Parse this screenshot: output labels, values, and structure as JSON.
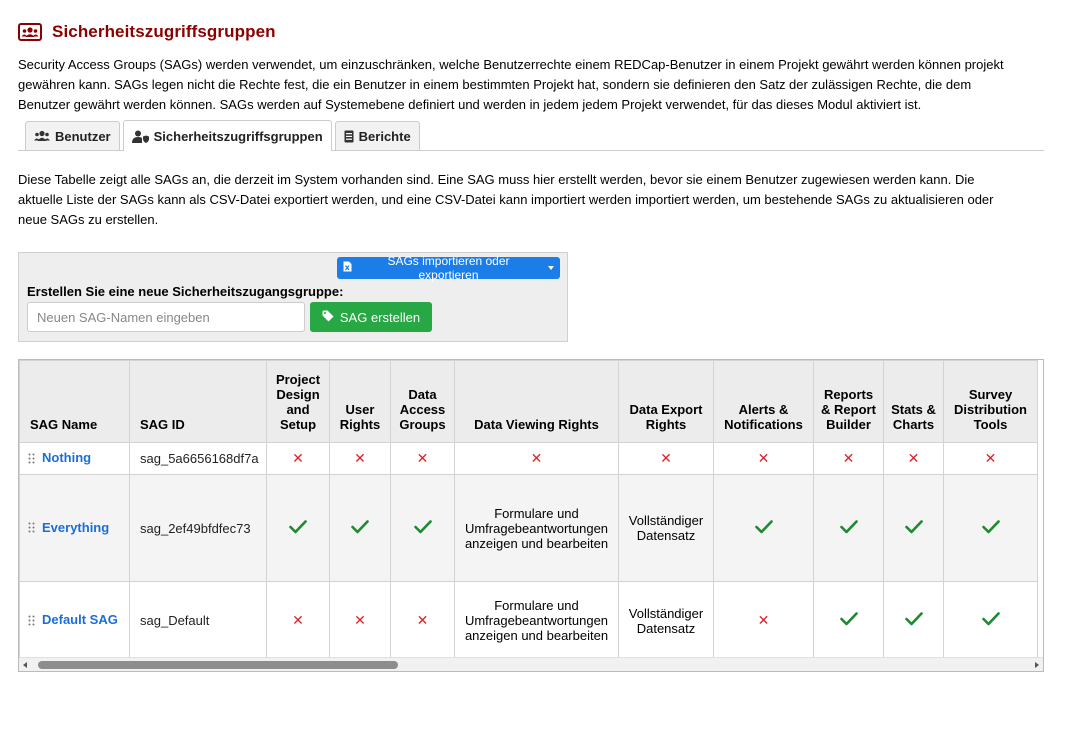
{
  "header": {
    "title": "Sicherheitszugriffsgruppen",
    "icon": "users-icon",
    "accent_color": "#8b0000"
  },
  "intro_text": "Security Access Groups (SAGs) werden verwendet, um einzuschränken, welche Benutzerrechte einem REDCap-Benutzer in einem Projekt gewährt werden können projekt gewähren kann. SAGs legen nicht die Rechte fest, die ein Benutzer in einem bestimmten Projekt hat, sondern sie definieren den Satz der zulässigen Rechte, die dem Benutzer gewährt werden können. SAGs werden auf Systemebene definiert und werden in jedem jedem Projekt verwendet, für das dieses Modul aktiviert ist.",
  "tabs": [
    {
      "label": "Benutzer",
      "icon": "users-icon",
      "active": false
    },
    {
      "label": "Sicherheitszugriffsgruppen",
      "icon": "user-shield-icon",
      "active": true
    },
    {
      "label": "Berichte",
      "icon": "document-icon",
      "active": false
    }
  ],
  "description": "Diese Tabelle zeigt alle SAGs an, die derzeit im System vorhanden sind. Eine SAG muss hier erstellt werden, bevor sie einem Benutzer zugewiesen werden kann. Die aktuelle Liste der SAGs kann als CSV-Datei exportiert werden, und eine CSV-Datei kann importiert werden importiert werden, um bestehende SAGs zu aktualisieren oder neue SAGs zu erstellen.",
  "create": {
    "export_button_label": "SAGs importieren oder exportieren",
    "label": "Erstellen Sie eine neue Sicherheitszugangsgruppe:",
    "input_placeholder": "Neuen SAG-Namen eingeben",
    "input_value": "",
    "create_button_label": "SAG erstellen",
    "export_color": "#1a7de8",
    "create_color": "#28a745"
  },
  "table": {
    "columns": [
      "SAG Name",
      "SAG ID",
      "Project Design and Setup",
      "User Rights",
      "Data Access Groups",
      "Data Viewing Rights",
      "Data Export Rights",
      "Alerts & Notifications",
      "Reports & Report Builder",
      "Stats & Charts",
      "Survey Distribution Tools"
    ],
    "rows": [
      {
        "name": "Nothing",
        "id": "sag_5a6656168df7a",
        "project_design": "x",
        "user_rights": "x",
        "dags": "x",
        "data_viewing": "x",
        "data_export": "x",
        "alerts": "x",
        "reports": "x",
        "stats": "x",
        "survey_dist": "x"
      },
      {
        "name": "Everything",
        "id": "sag_2ef49bfdfec73",
        "project_design": "check",
        "user_rights": "check",
        "dags": "check",
        "data_viewing": "Formulare und Umfragebeantwortungen anzeigen und bearbeiten",
        "data_export": "Vollständiger Datensatz",
        "alerts": "check",
        "reports": "check",
        "stats": "check",
        "survey_dist": "check"
      },
      {
        "name": "Default SAG",
        "id": "sag_Default",
        "project_design": "x",
        "user_rights": "x",
        "dags": "x",
        "data_viewing": "Formulare und Umfragebeantwortungen anzeigen und bearbeiten",
        "data_export": "Vollständiger Datensatz",
        "alerts": "x",
        "reports": "check",
        "stats": "check",
        "survey_dist": "check"
      }
    ],
    "x_symbol": "✕",
    "x_color": "#d9262d",
    "check_color": "#1e8a2e"
  }
}
